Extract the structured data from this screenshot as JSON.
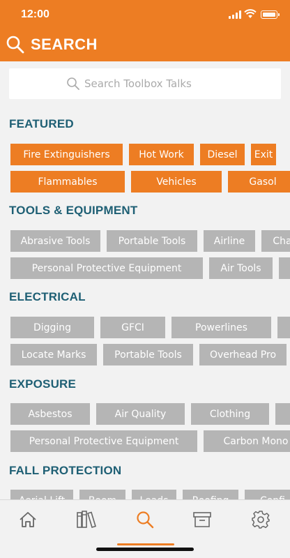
{
  "status": {
    "time": "12:00"
  },
  "header": {
    "title": "SEARCH"
  },
  "search": {
    "placeholder": "Search Toolbox Talks"
  },
  "sections": [
    {
      "title": "FEATURED",
      "style": "orange",
      "rows": [
        [
          "Fire Extinguishers",
          "Hot Work",
          "Diesel",
          "Exit"
        ],
        [
          "Flammables",
          "Vehicles",
          "Gasol"
        ]
      ]
    },
    {
      "title": "TOOLS & EQUIPMENT",
      "style": "gray",
      "rows": [
        [
          "Abrasive Tools",
          "Portable Tools",
          "Airline",
          "Cha"
        ],
        [
          "Personal Protective Equipment",
          "Air Tools",
          ""
        ]
      ]
    },
    {
      "title": "ELECTRICAL",
      "style": "gray",
      "rows": [
        [
          "Digging",
          "GFCI",
          "Powerlines",
          ""
        ],
        [
          "Locate Marks",
          "Portable Tools",
          "Overhead Pro"
        ]
      ]
    },
    {
      "title": "EXPOSURE",
      "style": "gray",
      "rows": [
        [
          "Asbestos",
          "Air Quality",
          "Clothing",
          ""
        ],
        [
          "Personal Protective Equipment",
          "Carbon Mono"
        ]
      ]
    },
    {
      "title": "FALL PROTECTION",
      "style": "gray",
      "rows": [
        [
          "Aerial Lift",
          "Boom",
          "Leads",
          "Roofing",
          "Confi"
        ]
      ]
    }
  ],
  "tabbar": {
    "items": [
      {
        "name": "home-icon",
        "active": false
      },
      {
        "name": "library-books-icon",
        "active": false
      },
      {
        "name": "search-icon",
        "active": true
      },
      {
        "name": "archive-box-icon",
        "active": false
      },
      {
        "name": "settings-gear-icon",
        "active": false
      }
    ]
  },
  "colors": {
    "accent": "#ed7d23",
    "section_title": "#1e5f74",
    "chip_gray": "#b5b5b5",
    "background": "#f2f2f2",
    "inactive_icon": "#666666"
  }
}
